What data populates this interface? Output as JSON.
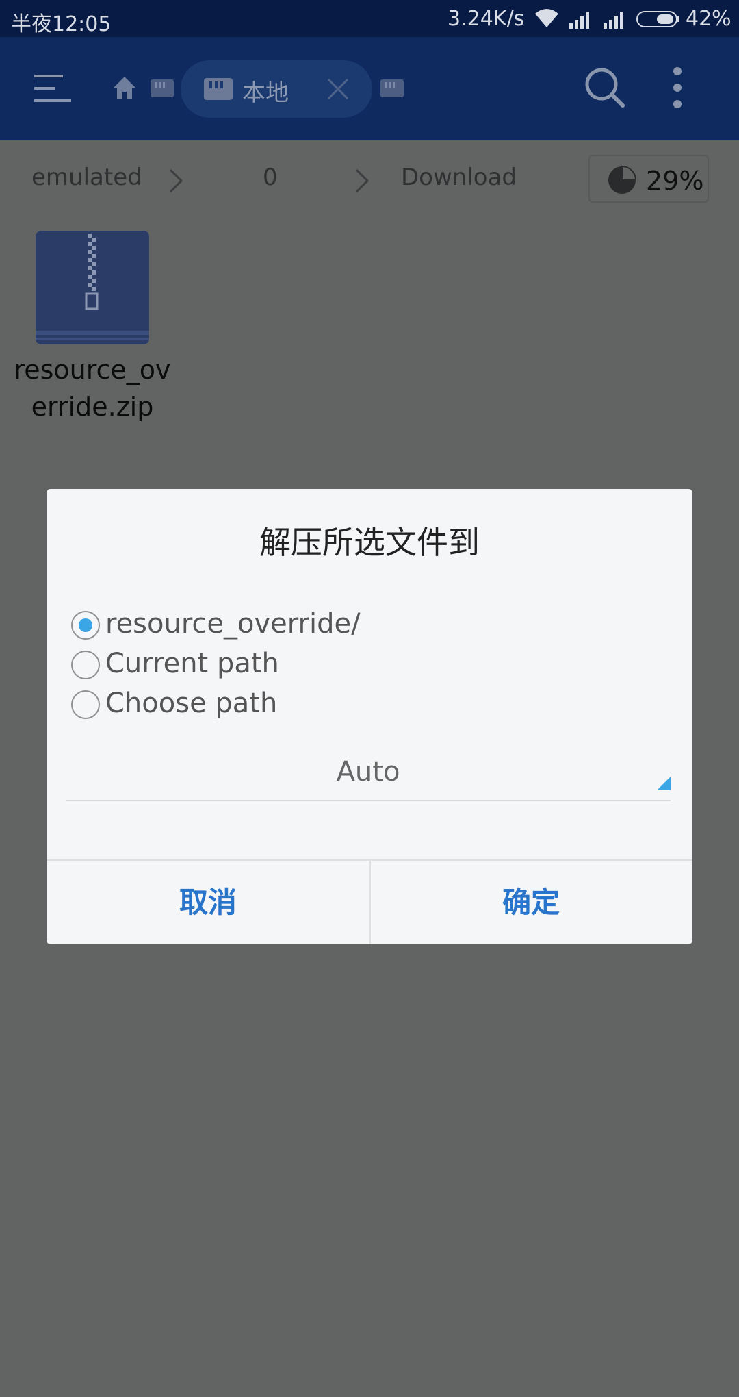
{
  "status_bar": {
    "time": "半夜12:05",
    "net_speed": "3.24K/s",
    "battery_percent": "42%",
    "icons": [
      "wifi-icon",
      "signal-icon",
      "signal-icon",
      "battery-icon"
    ]
  },
  "app_bar": {
    "tab_label": "本地",
    "icons": [
      "menu-icon",
      "home-icon",
      "sd-card-icon",
      "close-icon",
      "search-icon",
      "more-icon"
    ]
  },
  "breadcrumb": {
    "items": [
      "emulated",
      "0",
      "Download"
    ],
    "storage_percent": "29%"
  },
  "files": [
    {
      "name": "resource_override.zip",
      "icon": "zip-archive-icon"
    }
  ],
  "dialog": {
    "title": "解压所选文件到",
    "options": [
      {
        "label": "resource_override/",
        "checked": true
      },
      {
        "label": "Current path",
        "checked": false
      },
      {
        "label": "Choose path",
        "checked": false
      }
    ],
    "encoding_value": "Auto",
    "cancel_label": "取消",
    "ok_label": "确定"
  },
  "colors": {
    "status_bar_bg": "#081b45",
    "app_bar_bg": "#0e2a5e",
    "scrim_bg": "#626463",
    "dialog_bg": "#f4f6f8",
    "accent_blue": "#3aa6e6",
    "button_text": "#2a75cc"
  }
}
